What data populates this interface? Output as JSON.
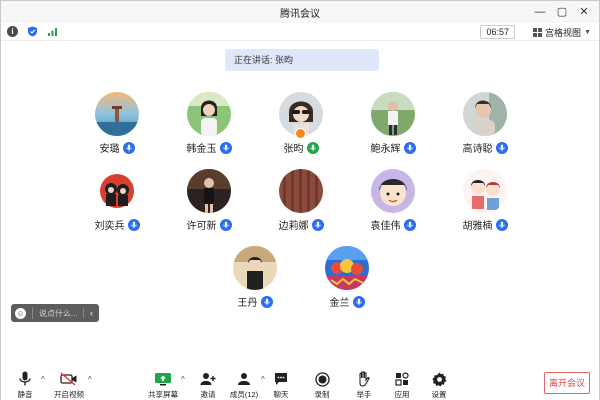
{
  "window": {
    "title": "腾讯会议",
    "controls": [
      "—",
      "▢",
      "✕"
    ]
  },
  "topbar": {
    "timer": "06:57",
    "view_label": "宫格视图"
  },
  "speaking": {
    "label": "正在讲话:",
    "name": "张昀"
  },
  "participants": [
    {
      "name": "安璐",
      "mic": "speaking"
    },
    {
      "name": "韩金玉",
      "mic": "on"
    },
    {
      "name": "张昀",
      "mic": "speaking",
      "host": true
    },
    {
      "name": "鲍永辉",
      "mic": "on"
    },
    {
      "name": "高诗聪",
      "mic": "on"
    },
    {
      "name": "刘奕兵",
      "mic": "on"
    },
    {
      "name": "许可新",
      "mic": "on"
    },
    {
      "name": "边莉娜",
      "mic": "on"
    },
    {
      "name": "袁佳伟",
      "mic": "on"
    },
    {
      "name": "胡雅楠",
      "mic": "on"
    },
    {
      "name": "王丹",
      "mic": "on"
    },
    {
      "name": "金兰",
      "mic": "on"
    }
  ],
  "chat": {
    "placeholder": "说点什么..."
  },
  "toolbar": {
    "mute": "静音",
    "video": "开启视频",
    "share": "共享屏幕",
    "invite": "邀请",
    "members": "成员(12)",
    "chat": "聊天",
    "record": "录制",
    "raise_hand": "举手",
    "apps": "应用",
    "settings": "设置",
    "leave": "离开会议"
  },
  "colors": {
    "mic_blue": "#2c6cf0",
    "mic_green": "#1fa64a",
    "leave_red": "#e14343",
    "banner": "#dfe8fb"
  }
}
